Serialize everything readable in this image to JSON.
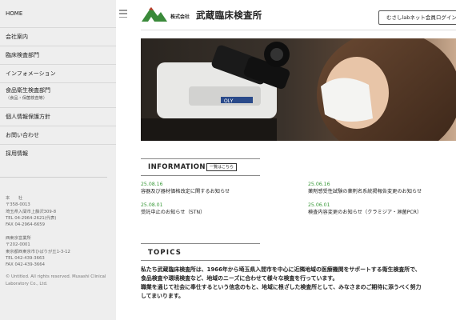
{
  "sidebar": {
    "items": [
      {
        "label": "HOME"
      },
      {
        "label": "会社案内"
      },
      {
        "label": "臨床検査部門"
      },
      {
        "label": "インフォメーション"
      },
      {
        "label": "食品衛生検査部門",
        "sub": "（食品・保菌検査等）"
      },
      {
        "label": "個人情報保護方針"
      },
      {
        "label": "お問い合わせ"
      },
      {
        "label": "採用情報"
      }
    ],
    "offices": {
      "hq": [
        "本　　社",
        "〒358-0013",
        "埼玉県入間市上藤沢309-8",
        "TEL 04-2964-2621(代表)",
        "FAX 04-2964-6659"
      ],
      "west": [
        "西東京営業所",
        "〒202-0001",
        "東京都西東京市ひばりが丘1-3-12",
        "TEL 042-439-3663",
        "FAX 042-439-3664"
      ]
    },
    "copyright": "© Untitled. All rights reserved. Musashi Clinical Laboratory Co., Ltd."
  },
  "header": {
    "company_prefix": "株式会社",
    "company_name": "武蔵臨床検査所",
    "member_login": "むさしlabネット会員ログイン"
  },
  "information": {
    "heading": "INFORMATION",
    "list_button": "一覧はこちら",
    "news": [
      {
        "date": "25.08.16",
        "title": "容器及び器材価格改定に関するお知らせ"
      },
      {
        "date": "25.06.16",
        "title": "薬剤感受性試験の薬剤名系統掲報告変更のお知らせ"
      },
      {
        "date": "25.08.01",
        "title": "受託中止のお知らせ（STN）"
      },
      {
        "date": "25.06.01",
        "title": "検査内容変更のお知らせ（クラミジア・淋菌PCR）"
      }
    ]
  },
  "topics": {
    "heading": "TOPICS",
    "lines": [
      "私たち武蔵臨床検査所は、1966年から埼玉県入間市を中心に近隣地域の医療機関をサポートする衛生検査所で、",
      "食品検査や環境検査など、地域のニーズに合わせて様々な検査を行っています。",
      "職業を通じて社会に奉仕するという信念のもと、地域に根ざした検査所として、みなさまのご期待に添うべく努力",
      "してまいります。"
    ]
  },
  "colors": {
    "sidebar_bg": "#eeeeee",
    "news_date": "#3a9a3a",
    "logo_green": "#3a8a3a",
    "logo_red": "#c0392b"
  },
  "icons": {
    "menu": "hamburger-menu-icon",
    "logo": "mountain-logo-icon"
  }
}
